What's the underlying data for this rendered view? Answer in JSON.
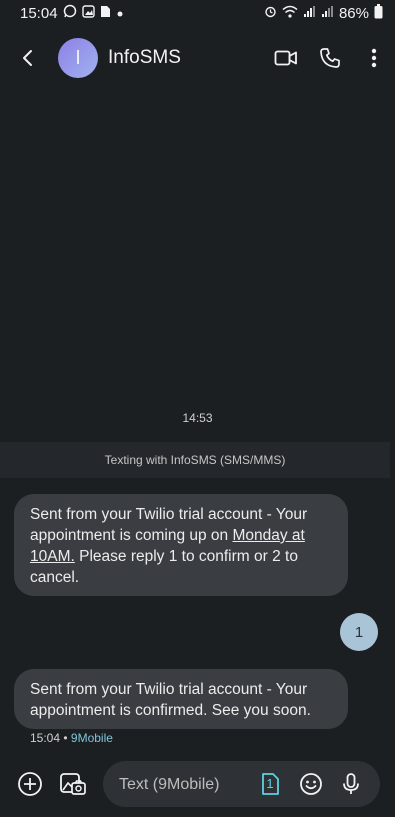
{
  "status_bar": {
    "time": "15:04",
    "battery": "86%"
  },
  "header": {
    "avatar_letter": "I",
    "contact_name": "InfoSMS"
  },
  "conversation": {
    "time_divider": "14:53",
    "texting_banner": "Texting with InfoSMS (SMS/MMS)",
    "msg1": {
      "part1": "Sent from your Twilio trial account - Your appointment is coming up on ",
      "link": "Monday at 10AM.",
      "part2": " Please reply 1 to confirm or 2 to cancel."
    },
    "reply": "1",
    "msg2": "Sent from your Twilio trial account - Your appointment is confirmed. See you soon.",
    "msg2_time": "15:04",
    "msg2_sep": " • ",
    "msg2_carrier": "9Mobile"
  },
  "composer": {
    "placeholder": "Text (9Mobile)",
    "sim_number": "1"
  },
  "colors": {
    "background": "#1c1f22",
    "incoming_bubble": "#3a3d41",
    "outgoing_bubble": "#a9c4d6",
    "carrier_accent": "#7ec4d8"
  }
}
